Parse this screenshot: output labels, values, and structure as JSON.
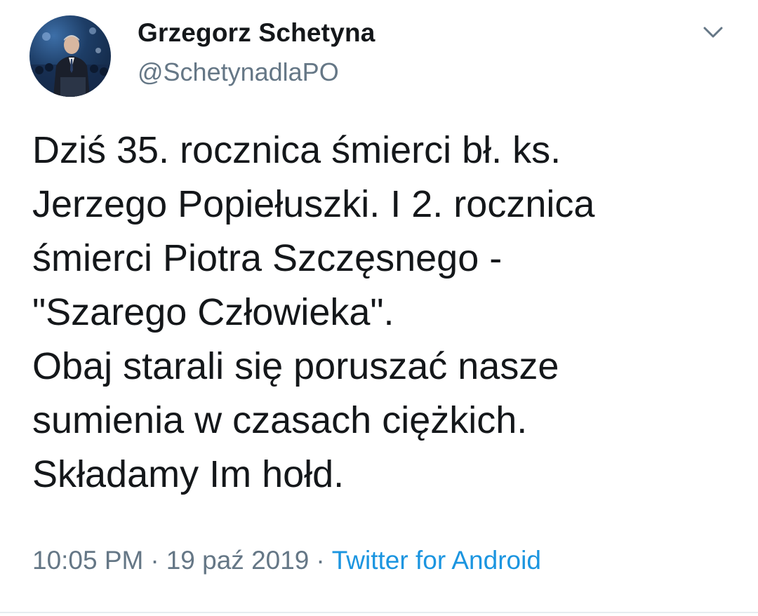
{
  "author": {
    "name": "Grzegorz Schetyna",
    "handle": "@SchetynadlaPO",
    "avatar_icon": "profile-photo"
  },
  "menu": {
    "icon": "chevron-down-icon"
  },
  "tweet": {
    "lines": [
      "Dziś 35. rocznica śmierci bł. ks.",
      "Jerzego Popiełuszki. I 2. rocznica",
      "śmierci Piotra Szczęsnego -",
      "\"Szarego Człowieka\".",
      "Obaj starali się poruszać nasze",
      "sumienia w czasach ciężkich.",
      "Składamy Im hołd."
    ]
  },
  "meta": {
    "time": "10:05 PM",
    "separator": "·",
    "date": "19 paź 2019",
    "source": "Twitter for Android"
  },
  "colors": {
    "text": "#14171a",
    "secondary": "#657786",
    "link": "#1b95e0"
  }
}
